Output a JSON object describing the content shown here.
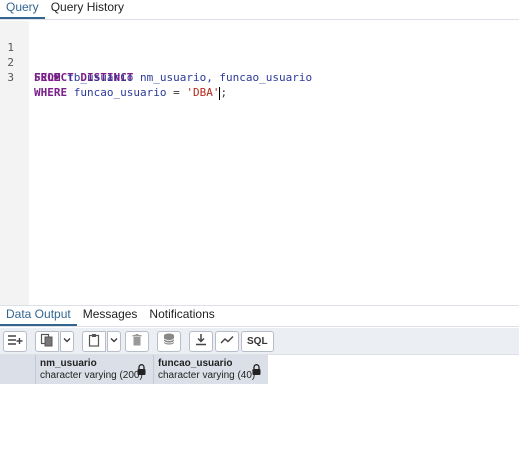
{
  "query_tabs": [
    {
      "label": "Query",
      "active": true
    },
    {
      "label": "Query History",
      "active": false
    }
  ],
  "editor": {
    "line_numbers": [
      "1",
      "2",
      "3"
    ],
    "lines": [
      {
        "keyword": "SELECT DISTINCT",
        "rest": " nm_usuario, funcao_usuario"
      },
      {
        "keyword": "FROM",
        "rest": " tb_usuario"
      },
      {
        "keyword": "WHERE",
        "ident": " funcao_usuario",
        "op": " = ",
        "string": "'DBA'",
        "end": ";"
      }
    ],
    "fold_icon": "chevron-down-icon"
  },
  "output_tabs": [
    {
      "label": "Data Output",
      "active": true
    },
    {
      "label": "Messages",
      "active": false
    },
    {
      "label": "Notifications",
      "active": false
    }
  ],
  "toolbar": {
    "buttons": [
      "add-row-icon",
      "copy-icon",
      "paste-icon",
      "delete-icon",
      "save-data-icon",
      "download-icon",
      "graph-icon"
    ],
    "sql_label": "SQL"
  },
  "columns": [
    {
      "name": "nm_usuario",
      "type": "character varying (200)"
    },
    {
      "name": "funcao_usuario",
      "type": "character varying (40)"
    }
  ],
  "colors": {
    "accent": "#326690",
    "keyword": "#7a1e8a",
    "identifier": "#2d3a9a",
    "string": "#b52a1d"
  }
}
